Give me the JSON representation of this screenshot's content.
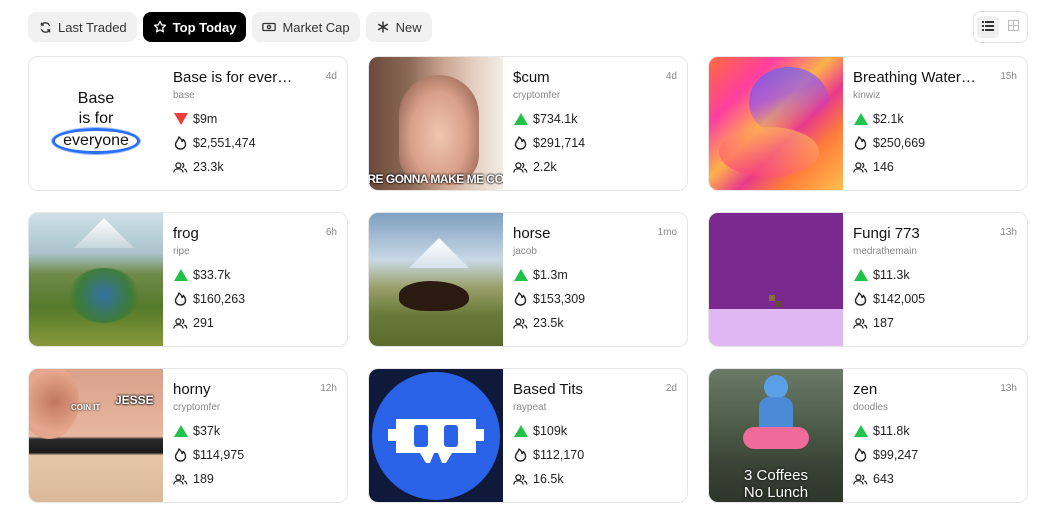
{
  "tabs": [
    {
      "label": "Last Traded",
      "icon": "refresh-icon",
      "active": false
    },
    {
      "label": "Top Today",
      "icon": "star-icon",
      "active": true
    },
    {
      "label": "Market Cap",
      "icon": "banknote-icon",
      "active": false
    },
    {
      "label": "New",
      "icon": "asterisk-icon",
      "active": false
    }
  ],
  "view_toggle": {
    "list_icon": "list-icon",
    "grid_icon": "grid-icon",
    "selected": "list"
  },
  "colors": {
    "up": "#22c24a",
    "down": "#ef3b3b",
    "active_tab": "#000000"
  },
  "coins": [
    {
      "title": "Base is for everyone",
      "handle": "base",
      "age": "4d",
      "market_cap": "$9m",
      "trend": "down",
      "volume": "$2,551,474",
      "holders": "23.3k",
      "thumb_text": {
        "line1": "Base",
        "line2": "is for",
        "line3": "everyone"
      }
    },
    {
      "title": "$cum",
      "handle": "cryptomfer",
      "age": "4d",
      "market_cap": "$734.1k",
      "trend": "up",
      "volume": "$291,714",
      "holders": "2.2k",
      "thumb_text": {
        "caption": "'RE GONNA MAKE ME COI"
      }
    },
    {
      "title": "Breathing Watercol...",
      "handle": "kinwiz",
      "age": "15h",
      "market_cap": "$2.1k",
      "trend": "up",
      "volume": "$250,669",
      "holders": "146"
    },
    {
      "title": "frog",
      "handle": "ripe",
      "age": "6h",
      "market_cap": "$33.7k",
      "trend": "up",
      "volume": "$160,263",
      "holders": "291"
    },
    {
      "title": "horse",
      "handle": "jacob",
      "age": "1mo",
      "market_cap": "$1.3m",
      "trend": "up",
      "volume": "$153,309",
      "holders": "23.5k"
    },
    {
      "title": "Fungi 773",
      "handle": "medrathemain",
      "age": "13h",
      "market_cap": "$11.3k",
      "trend": "up",
      "volume": "$142,005",
      "holders": "187"
    },
    {
      "title": "horny",
      "handle": "cryptomfer",
      "age": "12h",
      "market_cap": "$37k",
      "trend": "up",
      "volume": "$114,975",
      "holders": "189",
      "thumb_text": {
        "left": "COIN IT",
        "right": "JESSE"
      }
    },
    {
      "title": "Based Tits",
      "handle": "raypeat",
      "age": "2d",
      "market_cap": "$109k",
      "trend": "up",
      "volume": "$112,170",
      "holders": "16.5k"
    },
    {
      "title": "zen",
      "handle": "doodles",
      "age": "13h",
      "market_cap": "$11.8k",
      "trend": "up",
      "volume": "$99,247",
      "holders": "643",
      "thumb_text": {
        "line1": "3 Coffees",
        "line2": "No Lunch"
      }
    }
  ]
}
